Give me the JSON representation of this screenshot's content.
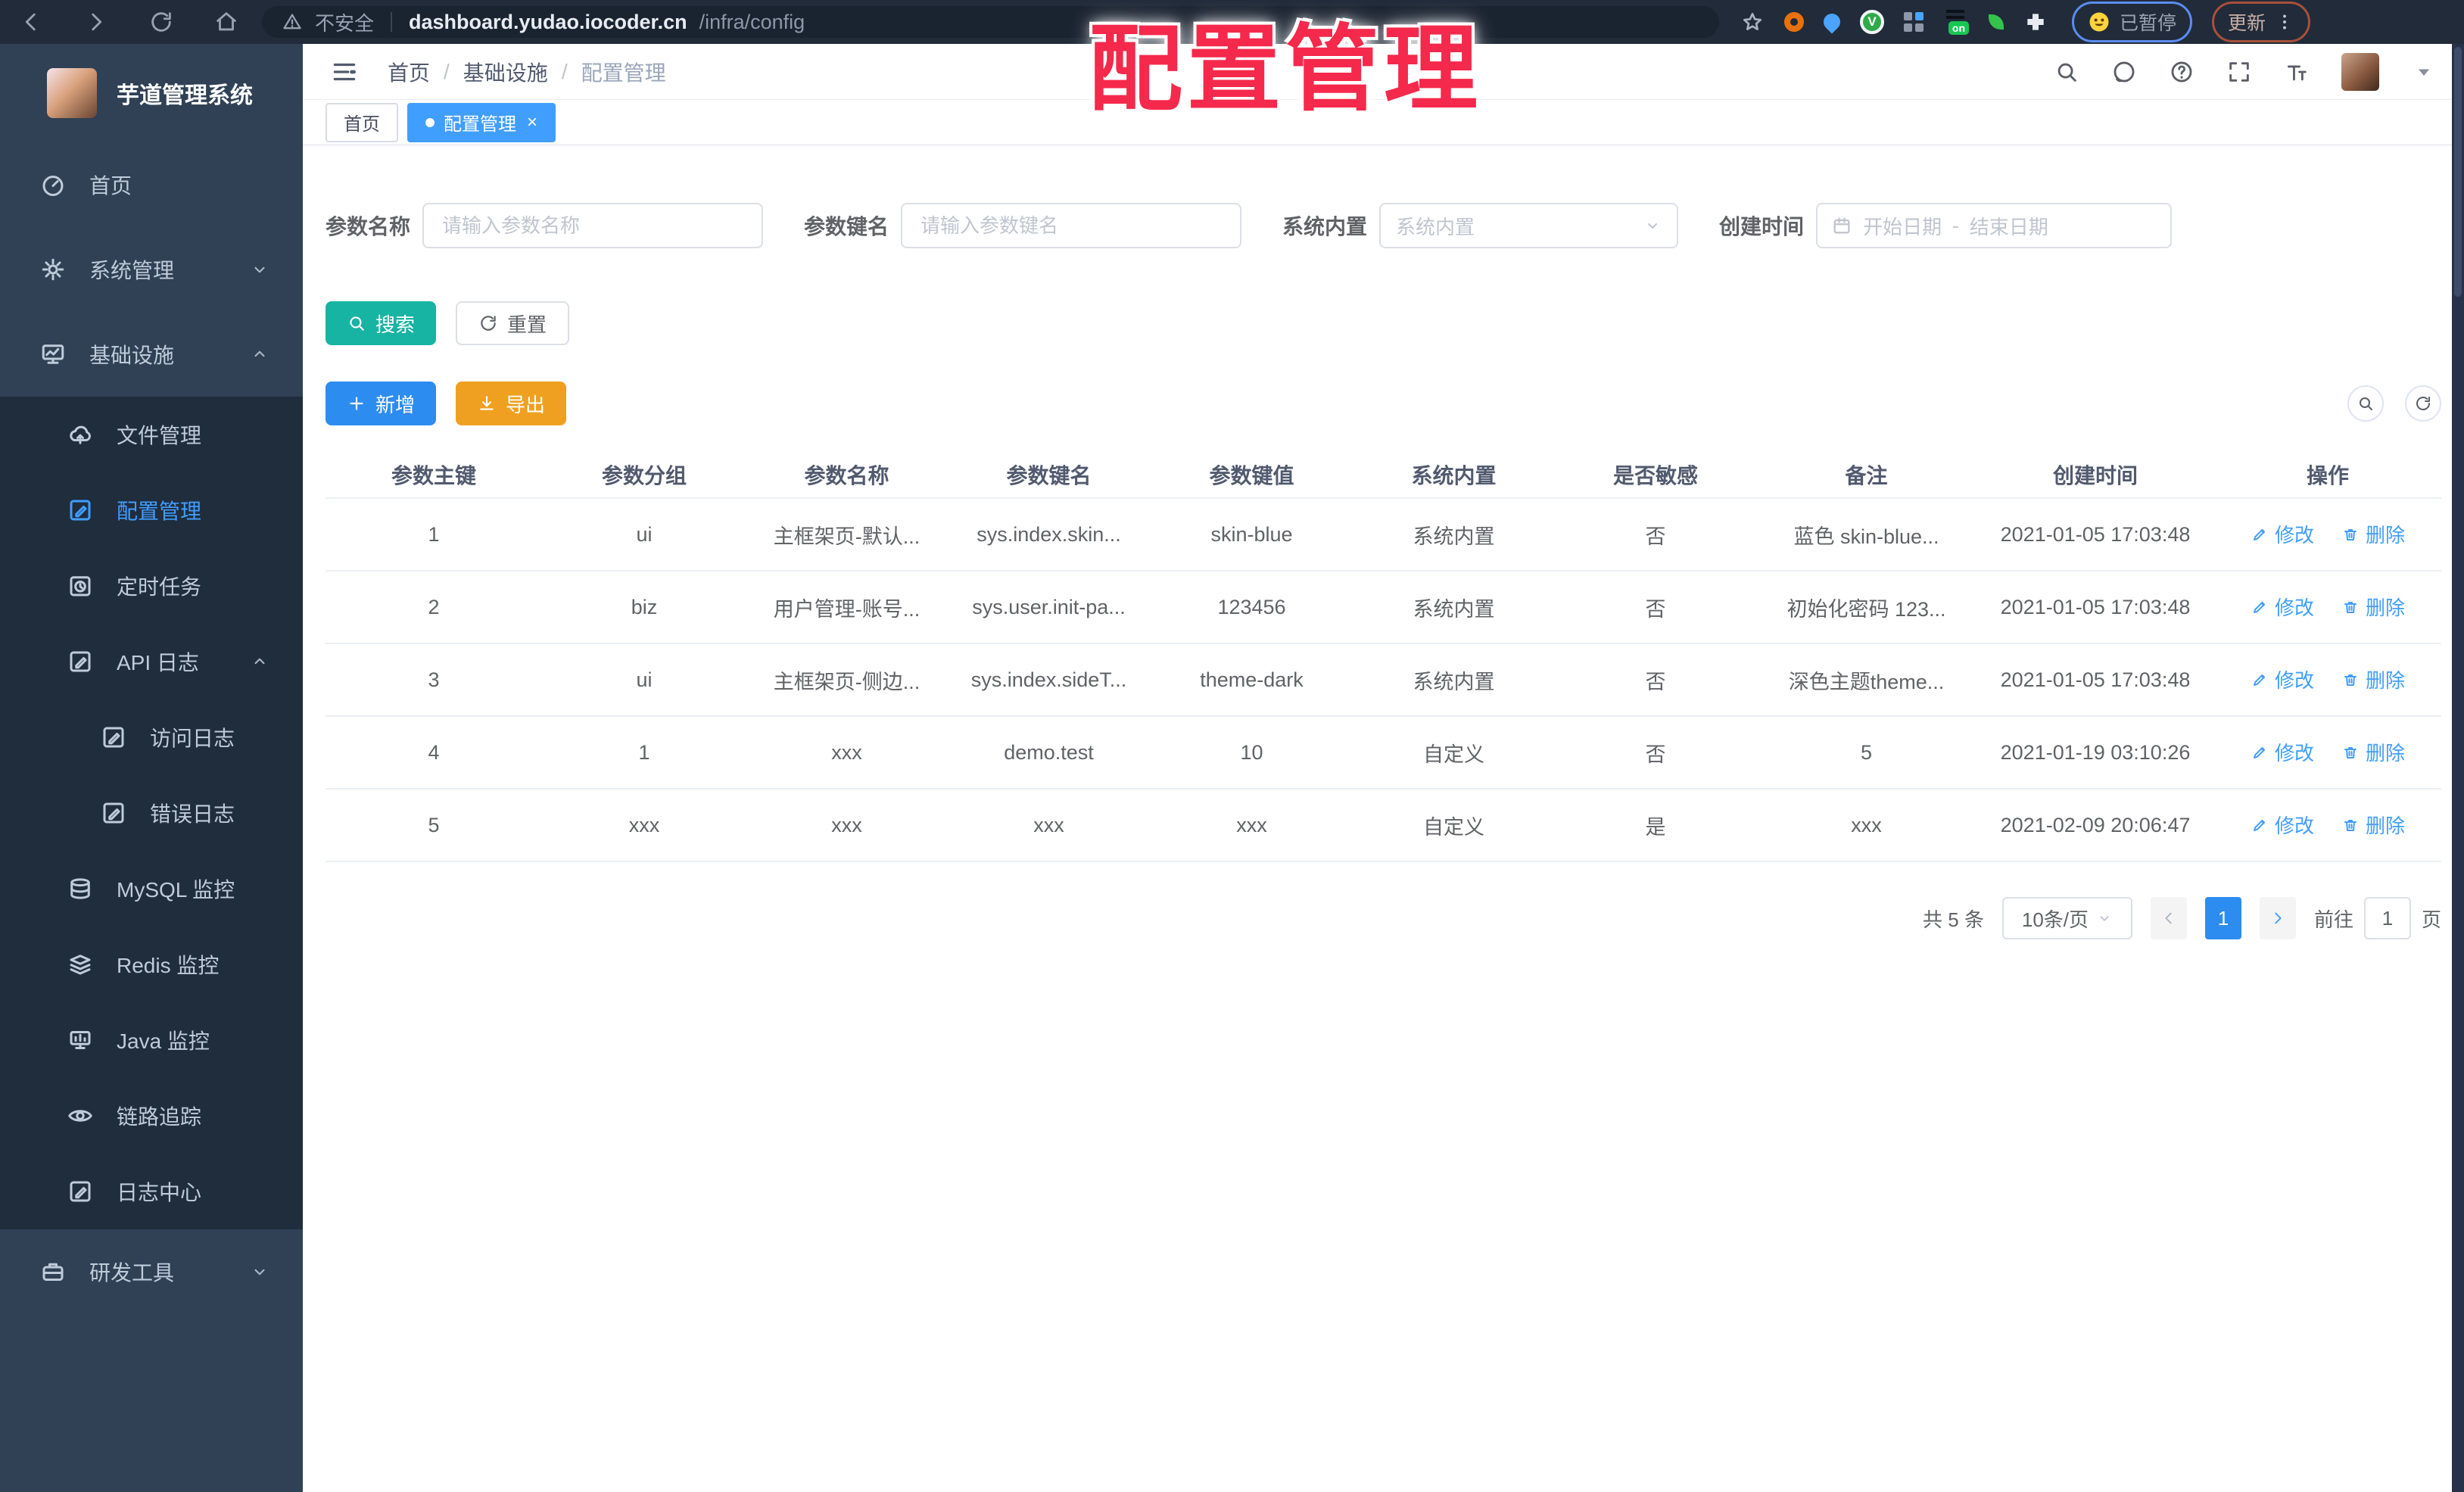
{
  "browser": {
    "security_label": "不安全",
    "url_host": "dashboard.yudao.iocoder.cn",
    "url_path": "/infra/config",
    "on_badge": "on",
    "paused_label": "已暂停",
    "update_label": "更新"
  },
  "watermark": "配置管理",
  "sidebar": {
    "title": "芋道管理系统",
    "items": [
      {
        "label": "首页",
        "icon": "dashboard-icon",
        "level": 1
      },
      {
        "label": "系统管理",
        "icon": "gear-icon",
        "level": 1,
        "chevron": "down"
      },
      {
        "label": "基础设施",
        "icon": "monitor-icon",
        "level": 1,
        "chevron": "up",
        "expanded": true
      },
      {
        "label": "文件管理",
        "icon": "cloud-upload-icon",
        "level": 2
      },
      {
        "label": "配置管理",
        "icon": "edit-square-icon",
        "level": 2,
        "active": true
      },
      {
        "label": "定时任务",
        "icon": "timer-icon",
        "level": 2
      },
      {
        "label": "API 日志",
        "icon": "log-icon",
        "level": 2,
        "chevron": "up",
        "expanded": true
      },
      {
        "label": "访问日志",
        "icon": "log-icon",
        "level": 3
      },
      {
        "label": "错误日志",
        "icon": "log-icon",
        "level": 3
      },
      {
        "label": "MySQL 监控",
        "icon": "mysql-icon",
        "level": 2
      },
      {
        "label": "Redis 监控",
        "icon": "redis-icon",
        "level": 2
      },
      {
        "label": "Java 监控",
        "icon": "java-icon",
        "level": 2
      },
      {
        "label": "链路追踪",
        "icon": "eye-icon",
        "level": 2
      },
      {
        "label": "日志中心",
        "icon": "log-icon",
        "level": 2
      },
      {
        "label": "研发工具",
        "icon": "briefcase-icon",
        "level": 1,
        "chevron": "down"
      }
    ]
  },
  "header": {
    "breadcrumb": [
      "首页",
      "基础设施",
      "配置管理"
    ]
  },
  "tabs": [
    {
      "label": "首页",
      "active": false
    },
    {
      "label": "配置管理",
      "active": true,
      "closable": true
    }
  ],
  "filters": {
    "name": {
      "label": "参数名称",
      "placeholder": "请输入参数名称"
    },
    "key": {
      "label": "参数键名",
      "placeholder": "请输入参数键名"
    },
    "builtin": {
      "label": "系统内置",
      "placeholder": "系统内置"
    },
    "created": {
      "label": "创建时间",
      "start_placeholder": "开始日期",
      "separator": "-",
      "end_placeholder": "结束日期"
    }
  },
  "buttons": {
    "search": "搜索",
    "reset": "重置",
    "add": "新增",
    "export": "导出"
  },
  "table": {
    "columns": [
      "参数主键",
      "参数分组",
      "参数名称",
      "参数键名",
      "参数键值",
      "系统内置",
      "是否敏感",
      "备注",
      "创建时间",
      "操作"
    ],
    "rows": [
      [
        "1",
        "ui",
        "主框架页-默认...",
        "sys.index.skin...",
        "skin-blue",
        "系统内置",
        "否",
        "蓝色 skin-blue...",
        "2021-01-05 17:03:48"
      ],
      [
        "2",
        "biz",
        "用户管理-账号...",
        "sys.user.init-pa...",
        "123456",
        "系统内置",
        "否",
        "初始化密码 123...",
        "2021-01-05 17:03:48"
      ],
      [
        "3",
        "ui",
        "主框架页-侧边...",
        "sys.index.sideT...",
        "theme-dark",
        "系统内置",
        "否",
        "深色主题theme...",
        "2021-01-05 17:03:48"
      ],
      [
        "4",
        "1",
        "xxx",
        "demo.test",
        "10",
        "自定义",
        "否",
        "5",
        "2021-01-19 03:10:26"
      ],
      [
        "5",
        "xxx",
        "xxx",
        "xxx",
        "xxx",
        "自定义",
        "是",
        "xxx",
        "2021-02-09 20:06:47"
      ]
    ],
    "row_actions": {
      "edit": "修改",
      "delete": "删除"
    }
  },
  "pagination": {
    "total": "共 5 条",
    "page_size": "10条/页",
    "current_page": "1",
    "goto_label": "前往",
    "goto_value": "1",
    "page_label": "页"
  },
  "colors": {
    "primary": "#409eff",
    "search_button": "#17b3a3",
    "add_button": "#2d8cf0",
    "export_button": "#f0a020",
    "sidebar_bg": "#304156",
    "submenu_bg": "#1f2d3d",
    "watermark": "#f5294b",
    "browser_bar": "#212b3a"
  }
}
